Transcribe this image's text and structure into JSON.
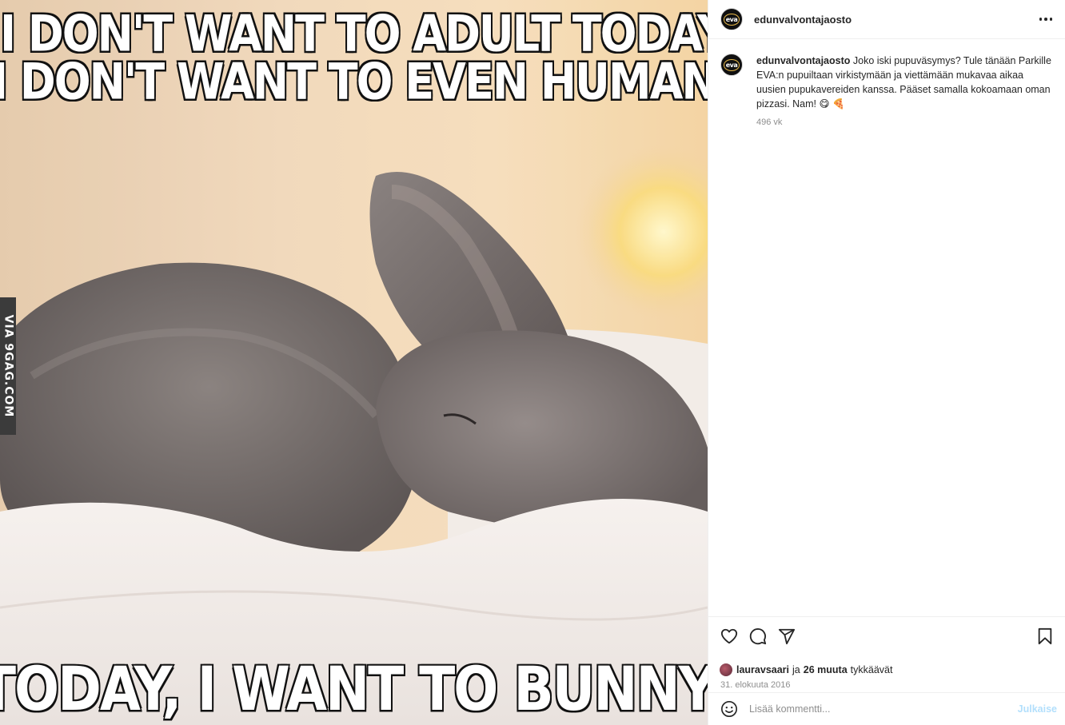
{
  "post": {
    "image": {
      "top_line_1": "I DON'T WANT TO ADULT TODAY.",
      "top_line_2": "I DON'T WANT TO EVEN HUMAN TODAY.",
      "bottom_line": "TODAY, I WANT TO BUNNY.",
      "watermark": "VIA 9GAG.COM"
    }
  },
  "header": {
    "username": "edunvalvontajaosto",
    "avatar_text": "eva",
    "more_icon": "more-horizontal-icon"
  },
  "caption": {
    "username": "edunvalvontajaosto",
    "text": "Joko iski pupuväsymys? Tule tänään Parkille EVA:n pupuiltaan virkistymään ja viettämään mukavaa aikaa uusien pupukavereiden kanssa. Pääset samalla kokoamaan oman pizzasi. Nam! 😋 🍕",
    "time": "496 vk"
  },
  "actions": {
    "like_icon": "heart-icon",
    "comment_icon": "comment-icon",
    "share_icon": "share-icon",
    "save_icon": "bookmark-icon"
  },
  "likes": {
    "user": "lauravsaari",
    "conjunction": "ja",
    "others": "26 muuta",
    "suffix": "tykkäävät"
  },
  "date": "31. elokuuta 2016",
  "comment": {
    "emoji_icon": "emoji-icon",
    "placeholder": "Lisää kommentti...",
    "post_label": "Julkaise"
  },
  "colors": {
    "accent": "#0095f6",
    "post_disabled": "#b2dffc",
    "secondary_text": "#8e8e8e",
    "border": "#efefef"
  }
}
